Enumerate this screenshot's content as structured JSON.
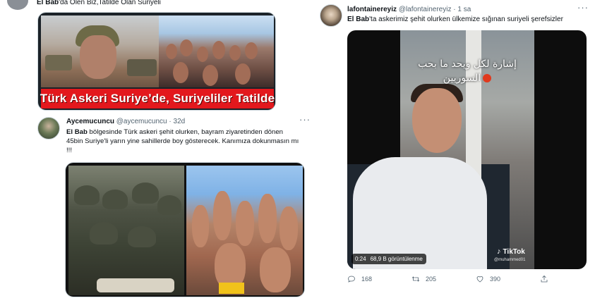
{
  "previous_tweet": {
    "mention": "El Bab",
    "text": "'da Ölen Biz,Tatilde Olan Suriyeli"
  },
  "banner": {
    "caption": "Türk Askeri Suriye’de, Suriyeliler Tatilde",
    "caption_color": "#e3181d"
  },
  "tweet2": {
    "name": "Aycemucuncu",
    "handle": "@aycemucuncu",
    "separator": "·",
    "time": "32d",
    "more": "···",
    "body_bold": "El Bab",
    "body_rest": " bölgesinde Türk askeri şehit olurken, bayram ziyaretinden dönen 45bin Suriye'li yarın yine sahillerde boy gösterecek. Kanımıza dokunmasın mı !!!"
  },
  "tweet3": {
    "name": "lafontainereyiz",
    "handle": "@lafontainereyiz",
    "separator": "·",
    "time": "1 sa",
    "more": "···",
    "body_bold": "El Bab",
    "body_rest": "'ta askerimiz şehit olurken ülkemize sığınan suriyeli şerefsizler",
    "video": {
      "overlay_line1": "إشارة لكل ويحد ما بحب",
      "overlay_line2": "السوريين",
      "tiktok_label": "TikTok",
      "tiktok_user": "@muhammed01",
      "duration": "0:24",
      "views": "68,9 B görüntülenme"
    },
    "actions": {
      "replies": "168",
      "retweets": "205",
      "likes": "390"
    }
  },
  "icons": {
    "reply": "reply-icon",
    "retweet": "retweet-icon",
    "like": "heart-icon",
    "share": "share-icon",
    "tiktok": "tiktok-icon"
  },
  "colors": {
    "text_primary": "#0f1419",
    "text_secondary": "#536471",
    "border": "#cfd9de"
  }
}
